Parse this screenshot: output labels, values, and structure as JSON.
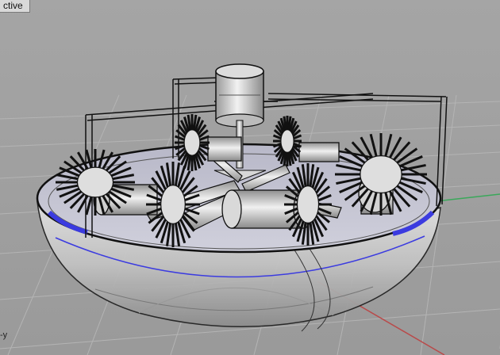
{
  "viewport": {
    "label": "ctive",
    "axis_label": "-y"
  },
  "colors": {
    "background": "#9e9e9e",
    "grid": "#b6b6b6",
    "x_axis": "#b94a4a",
    "y_axis": "#3aa85a",
    "edge_highlight": "#3b3be0",
    "model_edge": "#111111"
  }
}
